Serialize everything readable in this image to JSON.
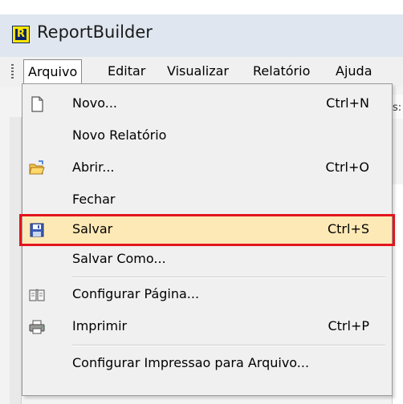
{
  "window": {
    "title": "ReportBuilder",
    "icon_letter": "R",
    "icon": "report-app-icon"
  },
  "menubar": {
    "items": [
      "Arquivo",
      "Editar",
      "Visualizar",
      "Relatório",
      "Ajuda"
    ],
    "active": "Arquivo"
  },
  "background_fragment": {
    "text": "s:"
  },
  "file_menu": {
    "items": [
      {
        "label": "Novo...",
        "shortcut": "Ctrl+N",
        "icon": "new-document-icon"
      },
      {
        "label": "Novo Relatório",
        "shortcut": "",
        "icon": ""
      },
      {
        "label": "Abrir...",
        "shortcut": "Ctrl+O",
        "icon": "open-folder-icon"
      },
      {
        "label": "Fechar",
        "shortcut": "",
        "icon": ""
      },
      {
        "label": "Salvar",
        "shortcut": "Ctrl+S",
        "icon": "save-disk-icon",
        "highlighted": true
      },
      {
        "label": "Salvar Como...",
        "shortcut": "",
        "icon": ""
      },
      {
        "label": "Configurar Página...",
        "shortcut": "",
        "icon": "page-setup-icon"
      },
      {
        "label": "Imprimir",
        "shortcut": "Ctrl+P",
        "icon": "printer-icon"
      },
      {
        "label": "Configurar Impressao para Arquivo...",
        "shortcut": "",
        "icon": ""
      }
    ]
  },
  "colors": {
    "highlight_fill": "#fde9b6",
    "annotation_border": "#e2151d",
    "menu_bg": "#f0f0f0",
    "titlebar_bg": "#dfe6ef"
  }
}
